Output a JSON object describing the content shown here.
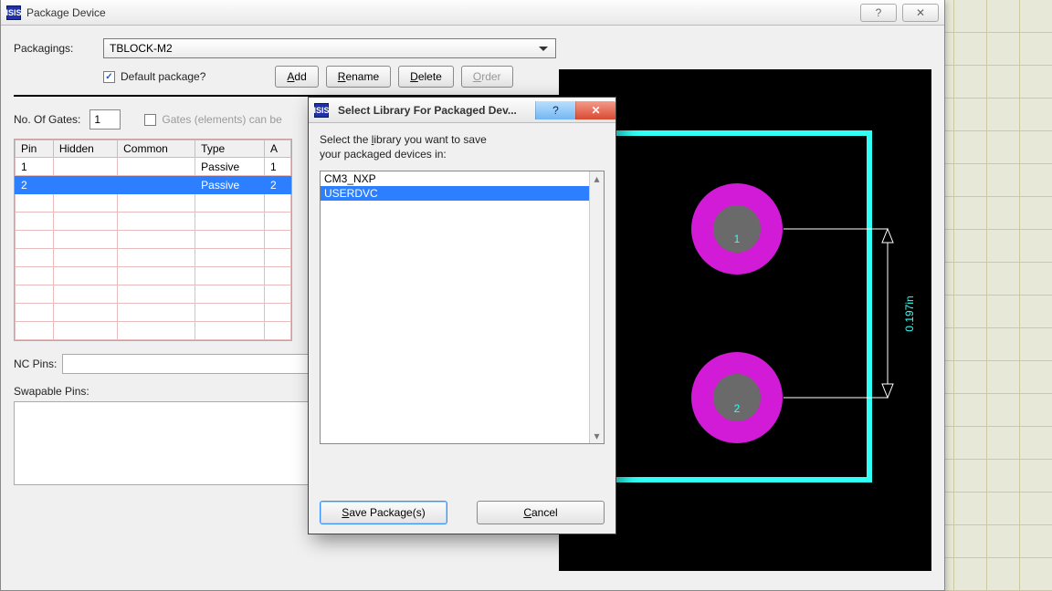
{
  "main": {
    "title": "Package Device",
    "packagings_label": "Packagings:",
    "packagings_value": "TBLOCK-M2",
    "default_pkg_label": "Default package?",
    "default_pkg_checked": true,
    "buttons": {
      "add": "Add",
      "rename": "Rename",
      "delete": "Delete",
      "order": "Order"
    },
    "gates": {
      "label": "No. Of Gates:",
      "value": "1",
      "hint": "Gates (elements) can be"
    },
    "table": {
      "headers": [
        "Pin",
        "Hidden",
        "Common",
        "Type",
        "A"
      ],
      "rows": [
        {
          "pin": "1",
          "hidden": "",
          "common": "",
          "type": "Passive",
          "a": "1",
          "sel": false
        },
        {
          "pin": "2",
          "hidden": "",
          "common": "",
          "type": "Passive",
          "a": "2",
          "sel": true
        }
      ]
    },
    "ncpins_label": "NC Pins:",
    "swappable_label": "Swapable Pins:"
  },
  "preview": {
    "outline_color": "#30fff6",
    "pad_color": "#d11bd6",
    "pad_inner": "#6a6a6a",
    "dimension": "0.197in",
    "pad_labels": [
      "1",
      "2"
    ]
  },
  "modal": {
    "title": "Select Library For Packaged Dev...",
    "msg_line1": "Select the library you want to save",
    "msg_line2": "your packaged devices in:",
    "items": [
      {
        "name": "CM3_NXP",
        "sel": false
      },
      {
        "name": "USERDVC",
        "sel": true
      }
    ],
    "save_label": "Save Package(s)",
    "cancel_label": "Cancel"
  }
}
